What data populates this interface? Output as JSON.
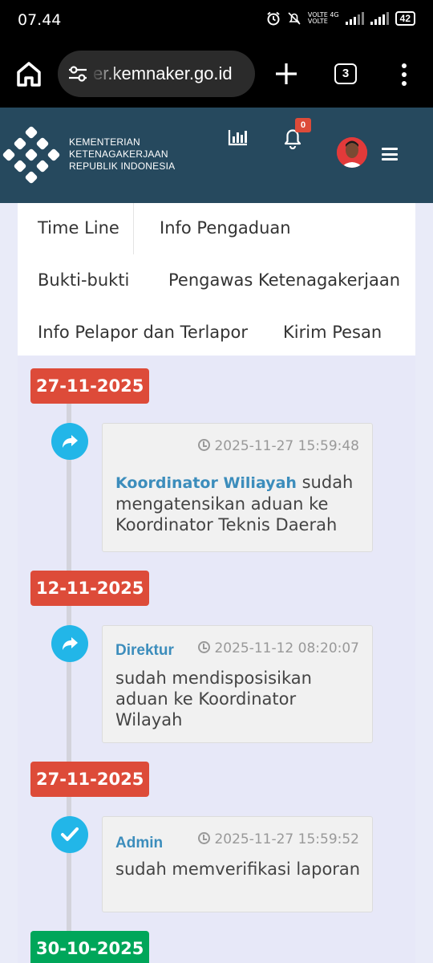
{
  "status_bar": {
    "time": "07.44",
    "network_label_1": "VOLTE 4G",
    "network_label_2": "VOLTE",
    "battery": "42"
  },
  "browser": {
    "url": "er.kemnaker.go.id",
    "tab_count": "3"
  },
  "site_header": {
    "logo_lines": [
      "KEMENTERIAN",
      "KETENAGAKERJAAN",
      "REPUBLIK INDONESIA"
    ],
    "notification_count": "0",
    "brand_color": "#26495e"
  },
  "tabs": [
    {
      "label": "Time Line"
    },
    {
      "label": "Info Pengaduan"
    },
    {
      "label": "Bukti-bukti"
    },
    {
      "label": "Pengawas Ketenagakerjaan"
    },
    {
      "label": "Info Pelapor dan Terlapor"
    },
    {
      "label": "Kirim Pesan"
    }
  ],
  "timeline": {
    "entries": [
      {
        "date": "27-11-2025",
        "date_color": "#dd4b39",
        "icon": "share-arrow-icon",
        "timestamp": "2025-11-27 15:59:48",
        "actor": "Koordinator Wiliayah",
        "action": "sudah mengatensikan aduan ke Koordinator Teknis Daerah"
      },
      {
        "date": "12-11-2025",
        "date_color": "#dd4b39",
        "icon": "share-arrow-icon",
        "timestamp": "2025-11-12 08:20:07",
        "actor": "Direktur",
        "action": "sudah mendisposisikan aduan ke Koordinator Wilayah"
      },
      {
        "date": "27-11-2025",
        "date_color": "#dd4b39",
        "icon": "check-icon",
        "timestamp": "2025-11-27 15:59:52",
        "actor": "Admin",
        "action": "sudah memverifikasi laporan"
      },
      {
        "date": "30-10-2025",
        "date_color": "#00a65a"
      }
    ]
  }
}
